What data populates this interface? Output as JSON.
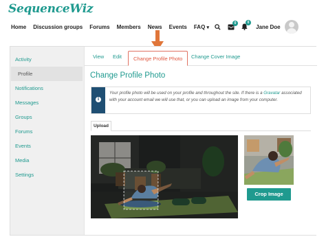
{
  "brand": {
    "name": "SequenceWiz"
  },
  "topnav": {
    "items": [
      "Home",
      "Discussion groups",
      "Forums",
      "Members",
      "News",
      "Events",
      "FAQ"
    ],
    "faq_chevron": "▾",
    "messages_badge": "0",
    "notifications_badge": "0",
    "user_name": "Jane Doe"
  },
  "sidebar": {
    "items": [
      {
        "label": "Activity"
      },
      {
        "label": "Profile"
      },
      {
        "label": "Notifications"
      },
      {
        "label": "Messages"
      },
      {
        "label": "Groups"
      },
      {
        "label": "Forums"
      },
      {
        "label": "Events"
      },
      {
        "label": "Media"
      },
      {
        "label": "Settings"
      }
    ]
  },
  "subtabs": {
    "items": [
      {
        "label": "View"
      },
      {
        "label": "Edit"
      },
      {
        "label": "Change Profile Photo"
      },
      {
        "label": "Change Cover Image"
      }
    ]
  },
  "main": {
    "title": "Change Profile Photo",
    "notice_before": "Your profile photo will be used on your profile and throughout the site. If there is a ",
    "notice_link": "Gravatar",
    "notice_after": " associated with your account email we will use that, or you can upload an image from your computer.",
    "upload_tab": "Upload",
    "crop_button": "Crop Image"
  },
  "icons": {
    "search": "search-icon",
    "messages": "inbox-icon",
    "notifications": "bell-icon",
    "info": "info-icon",
    "arrow": "arrow-down-icon",
    "avatar": "user-avatar-icon"
  },
  "colors": {
    "accent": "#1f9a8f",
    "active_tab": "#e0563f",
    "notice_bar": "#1f4f73",
    "arrow": "#e0763a"
  }
}
